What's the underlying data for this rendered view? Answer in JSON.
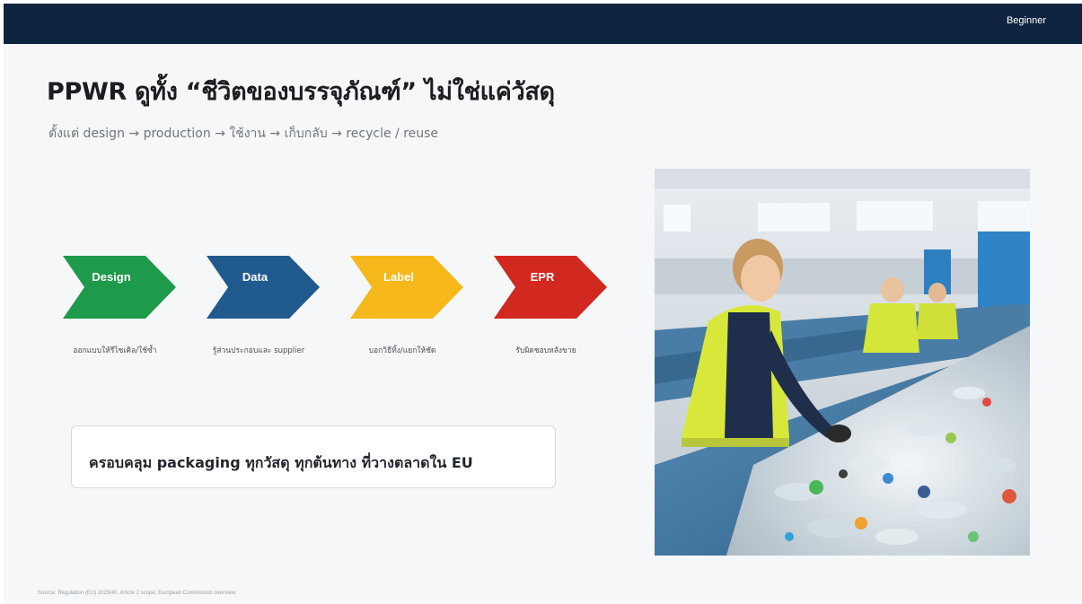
{
  "header": {
    "level_label": "Beginner"
  },
  "slide": {
    "title": "PPWR ดูทั้ง “ชีวิตของบรรจุภัณฑ์” ไม่ใช่แค่วัสดุ",
    "subtitle": "ตั้งแต่ design → production → ใช้งาน → เก็บกลับ → recycle / reuse",
    "steps": [
      {
        "label": "Design",
        "desc": "ออกแบบให้รีไซเคิล/ใช้ซ้ำ",
        "color": "#1e9a4b"
      },
      {
        "label": "Data",
        "desc": "รู้ส่วนประกอบและ supplier",
        "color": "#215a8f"
      },
      {
        "label": "Label",
        "desc": "บอกวิธีทิ้ง/แยกให้ชัด",
        "color": "#f6b81a"
      },
      {
        "label": "EPR",
        "desc": "รับผิดชอบหลังขาย",
        "color": "#d1281f"
      }
    ],
    "scope": "ครอบคลุม packaging ทุกวัสดุ ทุกต้นทาง ที่วางตลาดใน EU",
    "photo_alt": "Workers sorting plastic bottles on a recycling conveyor",
    "source": "Source: Regulation (EU) 2025/40, Article 2 scope; European Commission overview."
  },
  "colors": {
    "topbar": "#0f2440",
    "background": "#f6f7f8"
  }
}
